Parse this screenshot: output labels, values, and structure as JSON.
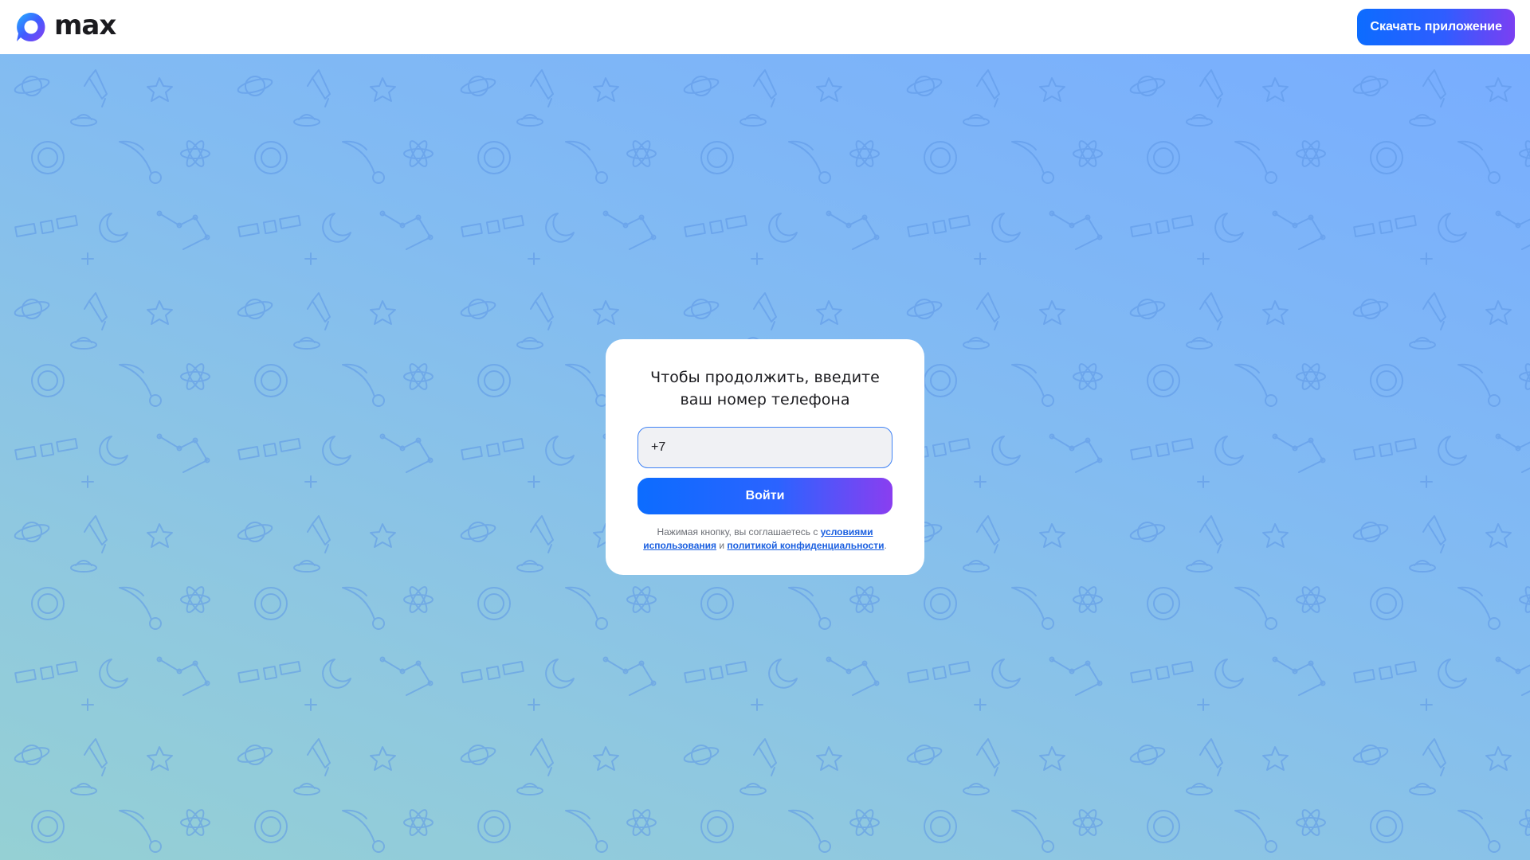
{
  "brand": {
    "logo_text": "max",
    "logo_icon": "max-logo-icon",
    "accent_start": "#0c6cff",
    "accent_end": "#8a3ef0"
  },
  "header": {
    "download_label": "Скачать приложение"
  },
  "login": {
    "title_line1": "Чтобы продолжить, введите",
    "title_line2": "ваш номер телефона",
    "phone_value": "+7",
    "submit_label": "Войти",
    "legal_prefix": "Нажимая кнопку, вы соглашаетесь с ",
    "terms_link": "условиями использования",
    "legal_conj": " и ",
    "privacy_link": "политикой конфиденциальности",
    "legal_suffix": "."
  },
  "background": {
    "gradient_top": "#78adff",
    "gradient_bottom": "#95d0d4",
    "pattern_theme": "space-doodles",
    "pattern_color": "#5a95e6"
  }
}
